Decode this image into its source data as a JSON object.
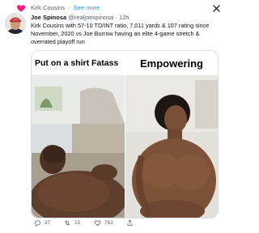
{
  "social_context": {
    "user": "Kirk Cousins",
    "separator": "·",
    "action_link": "See more"
  },
  "tweet": {
    "author_name": "Joe Spinosa",
    "handle": "@realjoespinosa",
    "separator": "·",
    "time": "12h",
    "text": "Kirk Cousins with 57-10 TD/INT ratio, 7,011 yards & 107 rating since November, 2020 vs Joe Burrow having an elite 4-game stretch & overrated playoff run"
  },
  "meme": {
    "left_caption": "Put on a shirt Fatass",
    "right_caption": "Empowering"
  },
  "actions": {
    "replies": "37",
    "retweets": "15",
    "likes": "761"
  },
  "colors": {
    "link": "#1d9bf0",
    "secondary_text": "#536471",
    "like": "#f91880"
  }
}
